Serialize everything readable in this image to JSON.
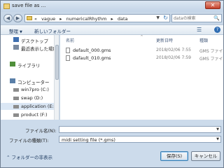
{
  "window": {
    "title": "save file as ...",
    "close": "✕"
  },
  "address": {
    "back": "◀",
    "forward": "▶",
    "path": [
      "«",
      "vague",
      "▸",
      "numericalRhythm",
      "▸",
      "data"
    ],
    "drop": "▼",
    "refresh": "↻"
  },
  "search": {
    "placeholder": "dataの検索",
    "icon": "🔍"
  },
  "toolbar": {
    "organize": "整理",
    "new_folder": "新しいフォルダー",
    "view_icon": "☰",
    "help": "?"
  },
  "sidebar": {
    "items": [
      {
        "label": "デスクトップ",
        "icon": "desktop-icon",
        "color": "#3f6fb0"
      },
      {
        "label": "最近表示した場所",
        "icon": "recent-places-icon",
        "color": "#7a8aa0"
      },
      {
        "label": "ライブラリ",
        "icon": "library-icon",
        "color": "#4f8f3a"
      },
      {
        "label": "コンピューター",
        "icon": "computer-icon",
        "color": "#5a7fa8"
      },
      {
        "label": "win7pro (C:)",
        "icon": "drive-icon",
        "color": "#8c8c8c"
      },
      {
        "label": "swap (D:)",
        "icon": "drive-icon",
        "color": "#8c8c8c"
      },
      {
        "label": "application (E:)",
        "icon": "drive-icon",
        "color": "#8c8c8c"
      },
      {
        "label": "product (F:)",
        "icon": "drive-icon",
        "color": "#8c8c8c"
      },
      {
        "label": "",
        "icon": "drive-icon",
        "color": "#8c8c8c"
      }
    ]
  },
  "filelist": {
    "columns": {
      "name": "名前",
      "date": "更新日時",
      "type": "種類"
    },
    "sort_indicator": "^",
    "rows": [
      {
        "name": "default_000.gms",
        "date": "2018/02/06 7:55",
        "type": "GMS ファイル"
      },
      {
        "name": "dafault_010.gms",
        "date": "2018/02/06 7:59",
        "type": "GMS ファイル"
      }
    ]
  },
  "form": {
    "filename_label": "ファイル名(N):",
    "filename_value": "",
    "filetype_label": "ファイルの種類(T):",
    "filetype_value": "midi setting file (*.gms)",
    "drop": "▼"
  },
  "actions": {
    "hide_folders": "フォルダーの非表示",
    "save": "保存(S)",
    "cancel": "キャンセル"
  }
}
